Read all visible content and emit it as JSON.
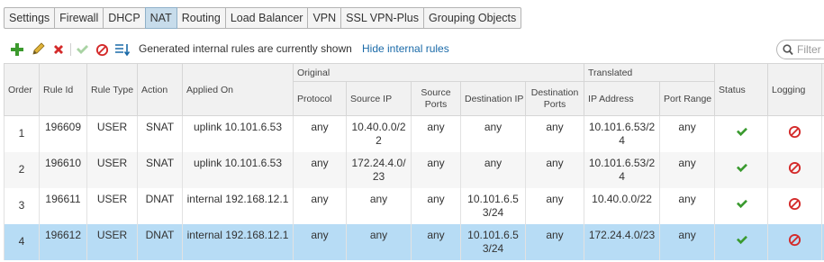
{
  "tabs": [
    {
      "label": "Settings",
      "active": false
    },
    {
      "label": "Firewall",
      "active": false
    },
    {
      "label": "DHCP",
      "active": false
    },
    {
      "label": "NAT",
      "active": true
    },
    {
      "label": "Routing",
      "active": false
    },
    {
      "label": "Load Balancer",
      "active": false
    },
    {
      "label": "VPN",
      "active": false
    },
    {
      "label": "SSL VPN-Plus",
      "active": false
    },
    {
      "label": "Grouping Objects",
      "active": false
    }
  ],
  "toolbar": {
    "status_text": "Generated internal rules are currently shown",
    "hide_link": "Hide internal rules",
    "filter_placeholder": "Filter",
    "icons": [
      "add-icon",
      "edit-icon",
      "delete-icon",
      "enable-icon",
      "disable-icon",
      "move-icon"
    ]
  },
  "columns": {
    "order": "Order",
    "rule_id": "Rule Id",
    "rule_type": "Rule Type",
    "action": "Action",
    "applied_on": "Applied On",
    "original_group": "Original",
    "protocol": "Protocol",
    "source_ip": "Source IP",
    "source_ports": "Source Ports",
    "destination_ip": "Destination IP",
    "destination_ports": "Destination Ports",
    "translated_group": "Translated",
    "ip_address": "IP Address",
    "port_range": "Port Range",
    "status": "Status",
    "logging": "Logging"
  },
  "rows": [
    {
      "order": "1",
      "rule_id": "196609",
      "rule_type": "USER",
      "action": "SNAT",
      "applied_on": "uplink 10.101.6.53",
      "protocol": "any",
      "source_ip": "10.40.0.0/22",
      "source_ports": "any",
      "destination_ip": "any",
      "destination_ports": "any",
      "ip_address": "10.101.6.53/24",
      "port_range": "any",
      "status": "enabled",
      "logging": "disabled"
    },
    {
      "order": "2",
      "rule_id": "196610",
      "rule_type": "USER",
      "action": "SNAT",
      "applied_on": "uplink 10.101.6.53",
      "protocol": "any",
      "source_ip": "172.24.4.0/23",
      "source_ports": "any",
      "destination_ip": "any",
      "destination_ports": "any",
      "ip_address": "10.101.6.53/24",
      "port_range": "any",
      "status": "enabled",
      "logging": "disabled"
    },
    {
      "order": "3",
      "rule_id": "196611",
      "rule_type": "USER",
      "action": "DNAT",
      "applied_on": "internal 192.168.12.1",
      "protocol": "any",
      "source_ip": "any",
      "source_ports": "any",
      "destination_ip": "10.101.6.53/24",
      "destination_ports": "any",
      "ip_address": "10.40.0.0/22",
      "port_range": "any",
      "status": "enabled",
      "logging": "disabled"
    },
    {
      "order": "4",
      "rule_id": "196612",
      "rule_type": "USER",
      "action": "DNAT",
      "applied_on": "internal 192.168.12.1",
      "protocol": "any",
      "source_ip": "any",
      "source_ports": "any",
      "destination_ip": "10.101.6.53/24",
      "destination_ports": "any",
      "ip_address": "172.24.4.0/23",
      "port_range": "any",
      "status": "enabled",
      "logging": "disabled",
      "selected": true
    }
  ],
  "colors": {
    "active_tab": "#c7dceb",
    "selected_row": "#b7dcf5",
    "link": "#1a6aa8",
    "status_ok": "#3a9a2f",
    "logging_off": "#d42a2a"
  }
}
